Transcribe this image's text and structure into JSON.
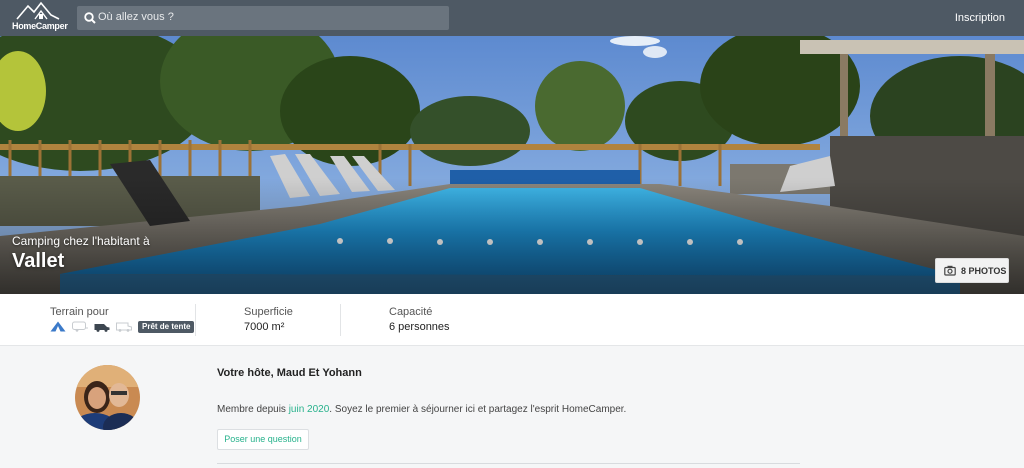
{
  "header": {
    "logo_text": "HomeCamper",
    "search_placeholder": "Où allez vous ?",
    "signup_label": "Inscription"
  },
  "hero": {
    "subtitle": "Camping chez l'habitant à",
    "title": "Vallet",
    "photos_label": "8 PHOTOS"
  },
  "info": {
    "terrain_label": "Terrain pour",
    "tent_badge": "Prêt de tente",
    "surface_label": "Superficie",
    "surface_value": "7000 m²",
    "capacity_label": "Capacité",
    "capacity_value": "6 personnes",
    "vehicle_icons": [
      "tent-icon",
      "caravan-icon",
      "van-icon",
      "camper-icon"
    ]
  },
  "host": {
    "title": "Votre hôte, Maud Et Yohann",
    "member_prefix": "Membre depuis ",
    "member_since": "juin 2020",
    "member_suffix": ". Soyez le premier à séjourner ici et partagez l'esprit HomeCamper.",
    "ask_button": "Poser une question"
  },
  "colors": {
    "header_bg": "#4e5964",
    "accent_green": "#27b28c"
  }
}
